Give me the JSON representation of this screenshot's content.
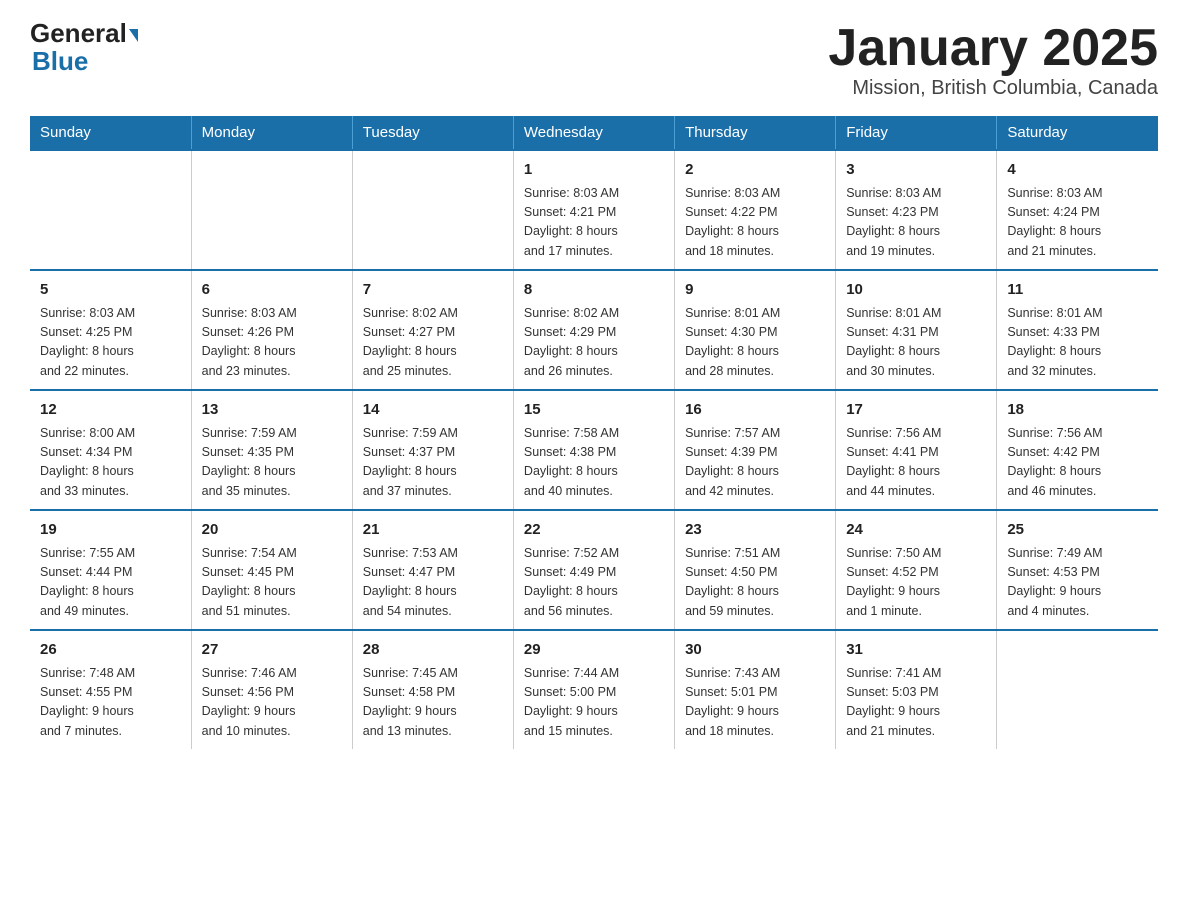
{
  "header": {
    "logo_main": "General",
    "logo_sub": "Blue",
    "title": "January 2025",
    "subtitle": "Mission, British Columbia, Canada"
  },
  "weekdays": [
    "Sunday",
    "Monday",
    "Tuesday",
    "Wednesday",
    "Thursday",
    "Friday",
    "Saturday"
  ],
  "weeks": [
    [
      {
        "day": "",
        "info": ""
      },
      {
        "day": "",
        "info": ""
      },
      {
        "day": "",
        "info": ""
      },
      {
        "day": "1",
        "info": "Sunrise: 8:03 AM\nSunset: 4:21 PM\nDaylight: 8 hours\nand 17 minutes."
      },
      {
        "day": "2",
        "info": "Sunrise: 8:03 AM\nSunset: 4:22 PM\nDaylight: 8 hours\nand 18 minutes."
      },
      {
        "day": "3",
        "info": "Sunrise: 8:03 AM\nSunset: 4:23 PM\nDaylight: 8 hours\nand 19 minutes."
      },
      {
        "day": "4",
        "info": "Sunrise: 8:03 AM\nSunset: 4:24 PM\nDaylight: 8 hours\nand 21 minutes."
      }
    ],
    [
      {
        "day": "5",
        "info": "Sunrise: 8:03 AM\nSunset: 4:25 PM\nDaylight: 8 hours\nand 22 minutes."
      },
      {
        "day": "6",
        "info": "Sunrise: 8:03 AM\nSunset: 4:26 PM\nDaylight: 8 hours\nand 23 minutes."
      },
      {
        "day": "7",
        "info": "Sunrise: 8:02 AM\nSunset: 4:27 PM\nDaylight: 8 hours\nand 25 minutes."
      },
      {
        "day": "8",
        "info": "Sunrise: 8:02 AM\nSunset: 4:29 PM\nDaylight: 8 hours\nand 26 minutes."
      },
      {
        "day": "9",
        "info": "Sunrise: 8:01 AM\nSunset: 4:30 PM\nDaylight: 8 hours\nand 28 minutes."
      },
      {
        "day": "10",
        "info": "Sunrise: 8:01 AM\nSunset: 4:31 PM\nDaylight: 8 hours\nand 30 minutes."
      },
      {
        "day": "11",
        "info": "Sunrise: 8:01 AM\nSunset: 4:33 PM\nDaylight: 8 hours\nand 32 minutes."
      }
    ],
    [
      {
        "day": "12",
        "info": "Sunrise: 8:00 AM\nSunset: 4:34 PM\nDaylight: 8 hours\nand 33 minutes."
      },
      {
        "day": "13",
        "info": "Sunrise: 7:59 AM\nSunset: 4:35 PM\nDaylight: 8 hours\nand 35 minutes."
      },
      {
        "day": "14",
        "info": "Sunrise: 7:59 AM\nSunset: 4:37 PM\nDaylight: 8 hours\nand 37 minutes."
      },
      {
        "day": "15",
        "info": "Sunrise: 7:58 AM\nSunset: 4:38 PM\nDaylight: 8 hours\nand 40 minutes."
      },
      {
        "day": "16",
        "info": "Sunrise: 7:57 AM\nSunset: 4:39 PM\nDaylight: 8 hours\nand 42 minutes."
      },
      {
        "day": "17",
        "info": "Sunrise: 7:56 AM\nSunset: 4:41 PM\nDaylight: 8 hours\nand 44 minutes."
      },
      {
        "day": "18",
        "info": "Sunrise: 7:56 AM\nSunset: 4:42 PM\nDaylight: 8 hours\nand 46 minutes."
      }
    ],
    [
      {
        "day": "19",
        "info": "Sunrise: 7:55 AM\nSunset: 4:44 PM\nDaylight: 8 hours\nand 49 minutes."
      },
      {
        "day": "20",
        "info": "Sunrise: 7:54 AM\nSunset: 4:45 PM\nDaylight: 8 hours\nand 51 minutes."
      },
      {
        "day": "21",
        "info": "Sunrise: 7:53 AM\nSunset: 4:47 PM\nDaylight: 8 hours\nand 54 minutes."
      },
      {
        "day": "22",
        "info": "Sunrise: 7:52 AM\nSunset: 4:49 PM\nDaylight: 8 hours\nand 56 minutes."
      },
      {
        "day": "23",
        "info": "Sunrise: 7:51 AM\nSunset: 4:50 PM\nDaylight: 8 hours\nand 59 minutes."
      },
      {
        "day": "24",
        "info": "Sunrise: 7:50 AM\nSunset: 4:52 PM\nDaylight: 9 hours\nand 1 minute."
      },
      {
        "day": "25",
        "info": "Sunrise: 7:49 AM\nSunset: 4:53 PM\nDaylight: 9 hours\nand 4 minutes."
      }
    ],
    [
      {
        "day": "26",
        "info": "Sunrise: 7:48 AM\nSunset: 4:55 PM\nDaylight: 9 hours\nand 7 minutes."
      },
      {
        "day": "27",
        "info": "Sunrise: 7:46 AM\nSunset: 4:56 PM\nDaylight: 9 hours\nand 10 minutes."
      },
      {
        "day": "28",
        "info": "Sunrise: 7:45 AM\nSunset: 4:58 PM\nDaylight: 9 hours\nand 13 minutes."
      },
      {
        "day": "29",
        "info": "Sunrise: 7:44 AM\nSunset: 5:00 PM\nDaylight: 9 hours\nand 15 minutes."
      },
      {
        "day": "30",
        "info": "Sunrise: 7:43 AM\nSunset: 5:01 PM\nDaylight: 9 hours\nand 18 minutes."
      },
      {
        "day": "31",
        "info": "Sunrise: 7:41 AM\nSunset: 5:03 PM\nDaylight: 9 hours\nand 21 minutes."
      },
      {
        "day": "",
        "info": ""
      }
    ]
  ]
}
